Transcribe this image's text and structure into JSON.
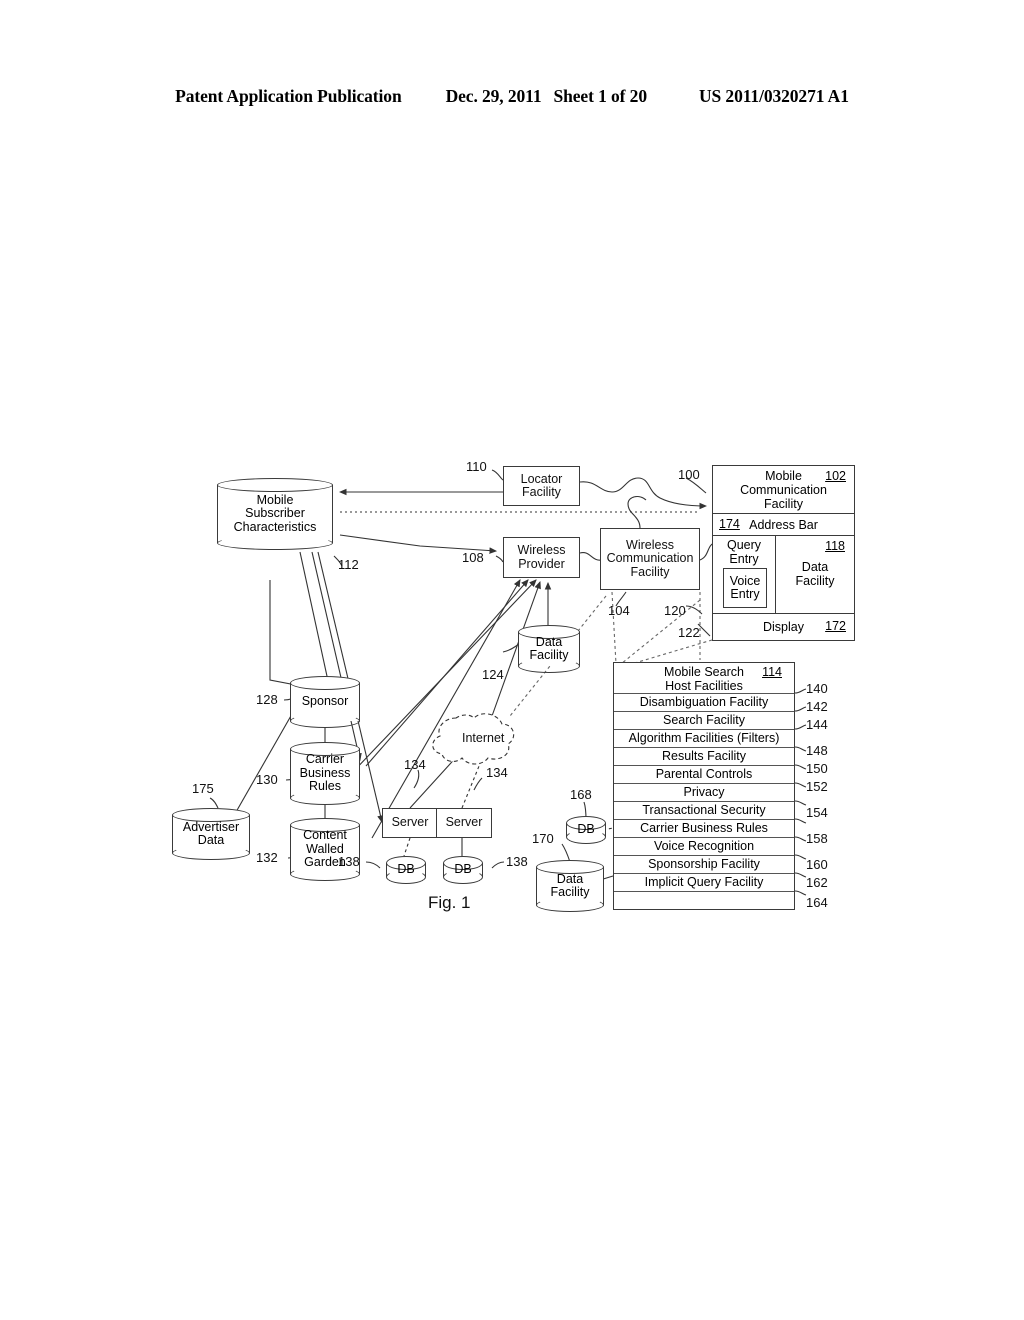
{
  "header": {
    "publication": "Patent Application Publication",
    "date": "Dec. 29, 2011",
    "sheet": "Sheet 1 of 20",
    "number": "US 2011/0320271 A1"
  },
  "figure": {
    "caption": "Fig. 1",
    "nodes": {
      "mobile_subscriber_characteristics": "Mobile\nSubscriber\nCharacteristics",
      "mobile_subscriber_characteristics_lines": [
        "Mobile",
        "Subscriber",
        "Characteristics"
      ],
      "locator_facility": [
        "Locator",
        "Facility"
      ],
      "wireless_provider": [
        "Wireless",
        "Provider"
      ],
      "wireless_communication_facility": [
        "Wireless",
        "Communication",
        "Facility"
      ],
      "data_facility_124": [
        "Data",
        "Facility"
      ],
      "sponsor": "Sponsor",
      "carrier_business_rules": [
        "Carrier",
        "Business",
        "Rules"
      ],
      "content_walled_garden": [
        "Content",
        "Walled",
        "Garden"
      ],
      "advertiser_data": [
        "Advertiser",
        "Data"
      ],
      "internet": "Internet",
      "server_left": "Server",
      "server_right": "Server",
      "db_left": "DB",
      "db_right": "DB",
      "db_168": "DB",
      "data_facility_170": [
        "Data",
        "Facility"
      ]
    },
    "mobile_communication_facility": {
      "title_lines": [
        "Mobile",
        "Communication",
        "Facility"
      ],
      "title_num": "102",
      "address_bar_label": "Address Bar",
      "address_bar_num": "174",
      "query_entry_lines": [
        "Query",
        "Entry"
      ],
      "voice_entry_lines": [
        "Voice",
        "Entry"
      ],
      "data_facility_lines": [
        "Data",
        "Facility"
      ],
      "data_facility_num": "118",
      "display_label": "Display",
      "display_num": "172"
    },
    "mobile_search_host": {
      "title_lines": [
        "Mobile Search",
        "Host Facilities"
      ],
      "title_num": "114",
      "rows": [
        "Disambiguation Facility",
        "Search Facility",
        "Algorithm Facilities (Filters)",
        "Results Facility",
        "Parental Controls",
        "Privacy",
        "Transactional Security",
        "Carrier Business Rules",
        "Voice Recognition",
        "Sponsorship Facility",
        "Implicit Query Facility",
        ""
      ]
    },
    "reference_numerals": {
      "n100": "100",
      "n104": "104",
      "n108": "108",
      "n110": "110",
      "n112": "112",
      "n120": "120",
      "n122": "122",
      "n124": "124",
      "n128": "128",
      "n130": "130",
      "n132": "132",
      "n134a": "134",
      "n134b": "134",
      "n138a": "138",
      "n138b": "138",
      "n140": "140",
      "n142": "142",
      "n144": "144",
      "n148": "148",
      "n150": "150",
      "n152": "152",
      "n154": "154",
      "n158": "158",
      "n160": "160",
      "n162": "162",
      "n164": "164",
      "n168": "168",
      "n170": "170",
      "n175": "175"
    }
  }
}
